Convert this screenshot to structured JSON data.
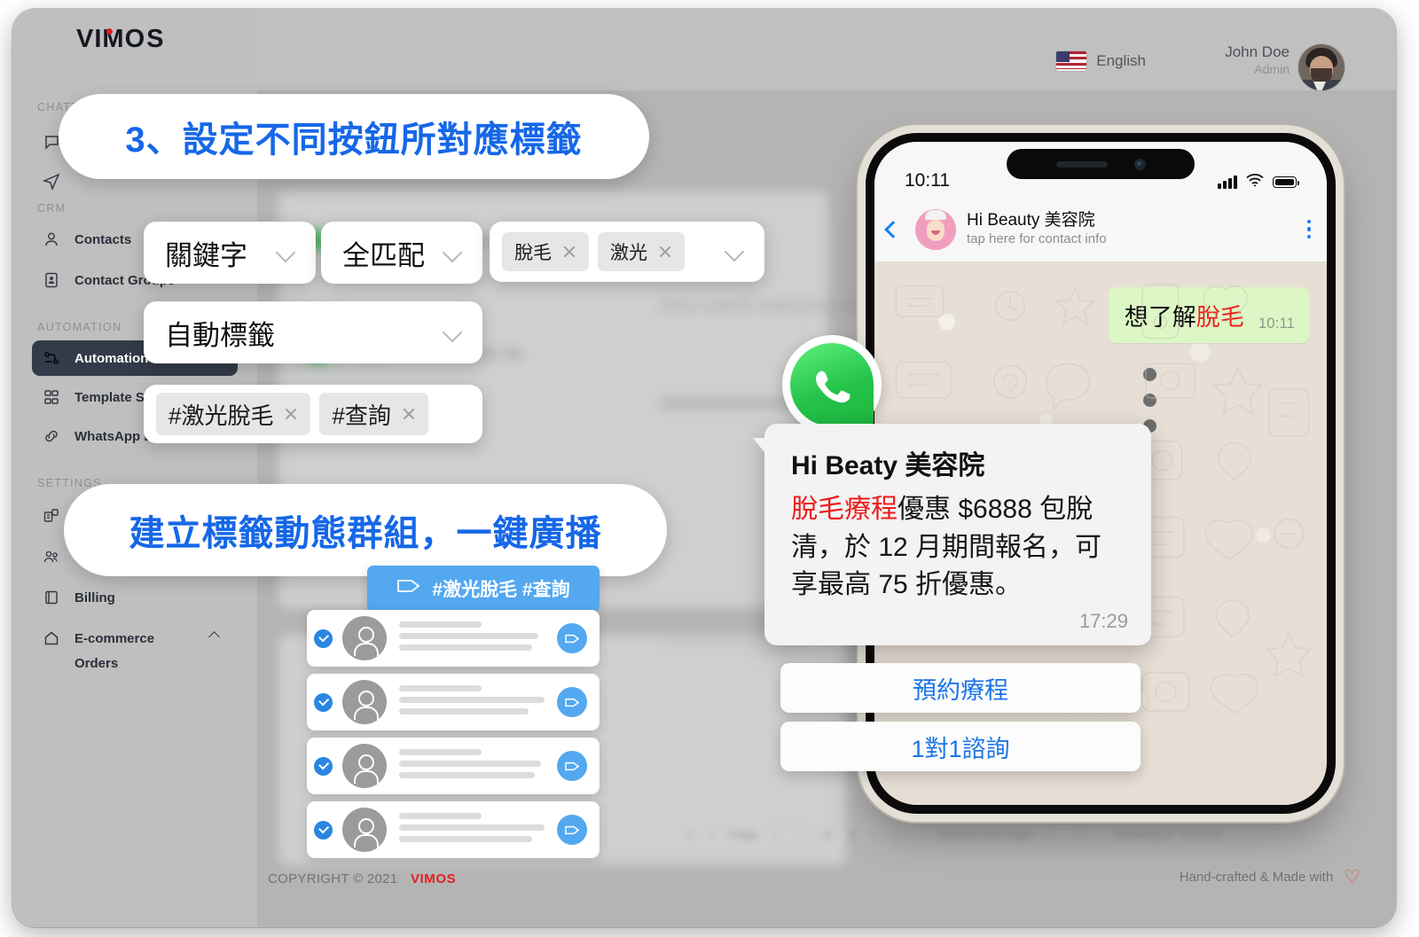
{
  "brand": {
    "logo": "VIM",
    "logo_tail": "S",
    "logo_oo": "O"
  },
  "sidebar": {
    "sections": [
      {
        "label": "CHATTING"
      },
      {
        "label": "CRM"
      },
      {
        "label": "AUTOMATION"
      },
      {
        "label": "SETTINGS"
      }
    ],
    "items": [
      {
        "label": "Contacts",
        "icon": "user-icon"
      },
      {
        "label": "Contact Groups",
        "icon": "contact-card-icon"
      },
      {
        "label": "Automation Rules",
        "icon": "automation-icon",
        "active": true
      },
      {
        "label": "Template Settings",
        "icon": "template-icon"
      },
      {
        "label": "WhatsApp Link",
        "icon": "link-icon"
      },
      {
        "label": "Billing",
        "icon": "book-icon"
      },
      {
        "label": "E-commerce",
        "icon": "home-icon"
      }
    ],
    "sub_items": [
      {
        "label": "Orders"
      }
    ]
  },
  "topbar": {
    "language": "English",
    "user_name": "John Doe",
    "user_role": "Admin"
  },
  "callouts": [
    {
      "text": "3、設定不同按鈕所對應標籤"
    },
    {
      "text": "建立標籤動態群組，一鍵廣播"
    }
  ],
  "form": {
    "keyword_type": "關鍵字",
    "match_type": "全匹配",
    "keywords": [
      "脫毛",
      "激光"
    ],
    "action_type": "自動標籤",
    "tags": [
      "#激光脫毛",
      "#查詢"
    ]
  },
  "contact_list": {
    "tag_badge": "#激光脫毛 #查詢",
    "rows": [
      {
        "selected": true
      },
      {
        "selected": true
      },
      {
        "selected": true
      },
      {
        "selected": true
      }
    ]
  },
  "background": {
    "note": "Auto-Reply will only be triggered in Open and Close chats.",
    "hint": "chat to a specific contact group, follow these steps",
    "toggle_labels": [
      "Active",
      "Auto-Reply",
      "Active",
      "Auto-Tag"
    ],
    "pagination": {
      "page_label": "Page",
      "page": "1",
      "of": "of",
      "total": "3",
      "rows_label": "Results per page",
      "rows": "8",
      "showing": "Showing 1 - 8 of 21"
    }
  },
  "phone": {
    "status_time": "10:11",
    "chat_title": "Hi Beauty 美容院",
    "chat_subtitle": "tap here for contact info",
    "outgoing": {
      "text_plain": "想了解",
      "text_highlight": "脫毛",
      "time": "10:11"
    },
    "promo": {
      "title": "Hi Beaty 美容院",
      "body_highlight": "脫毛療程",
      "body_rest": "優惠 $6888 包脫清，於 12 月期間報名，可享最高 75 折優惠。",
      "time": "17:29"
    },
    "reply_buttons": [
      "預約療程",
      "1對1諮詢"
    ]
  },
  "footer": {
    "copyright": "COPYRIGHT © 2021",
    "brand": "VIMOS",
    "credit": "Hand-crafted & Made with",
    "heart": "♡"
  },
  "colors": {
    "accent_blue": "#1667e8",
    "tag_blue": "#53a8f0",
    "whatsapp_green": "#25c44a",
    "bubble_green": "#dcf7c5",
    "highlight_red": "#ee1c1c",
    "brand_red": "#e02020",
    "sidebar_active": "#333a49"
  }
}
